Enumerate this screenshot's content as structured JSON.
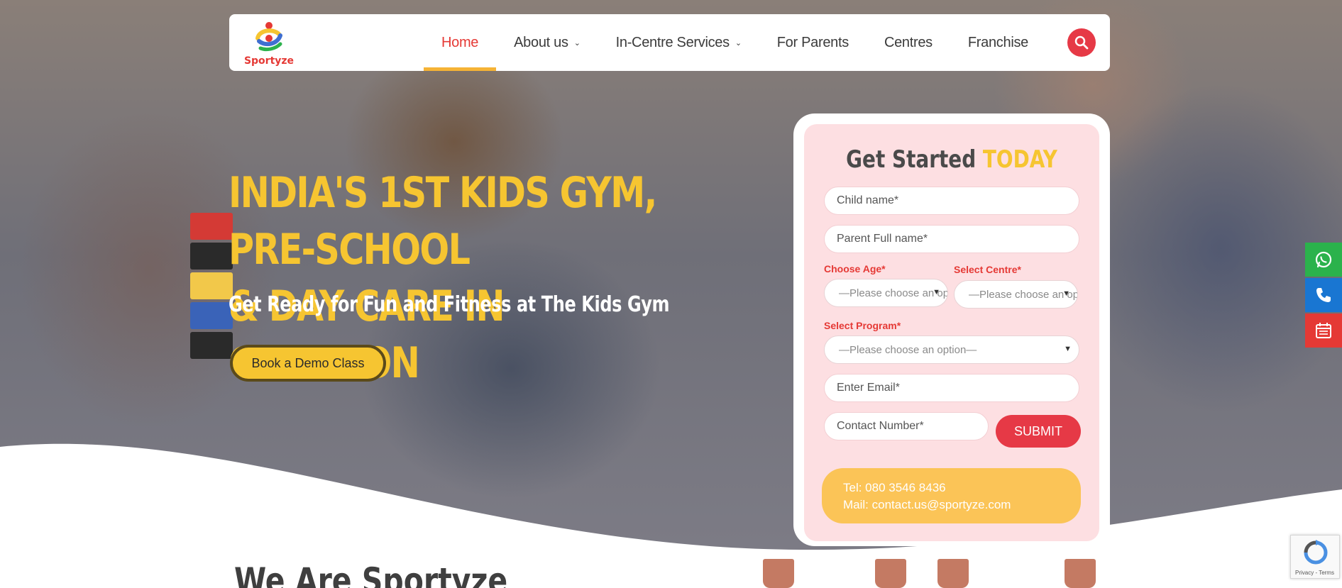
{
  "colors": {
    "brand_red": "#e63946",
    "brand_yellow": "#f6c531",
    "form_bg": "#fddfe2",
    "contact_bg": "#fbc457",
    "whatsapp": "#2bb24c",
    "phone": "#1976d2",
    "calendar": "#e53935"
  },
  "nav": {
    "logo_text": "Sportyze",
    "items": [
      {
        "label": "Home",
        "active": true,
        "dropdown": false
      },
      {
        "label": "About us",
        "active": false,
        "dropdown": true
      },
      {
        "label": "In-Centre Services",
        "active": false,
        "dropdown": true
      },
      {
        "label": "For Parents",
        "active": false,
        "dropdown": false
      },
      {
        "label": "Centres",
        "active": false,
        "dropdown": false
      },
      {
        "label": "Franchise",
        "active": false,
        "dropdown": false
      }
    ],
    "search_icon": "search-icon"
  },
  "hero": {
    "title_line1": "INDIA'S 1ST KIDS GYM, PRE-SCHOOL",
    "title_line2": "& DAY CARE IN GURGAON",
    "subtitle": "Get Ready for Fun and Fitness at The Kids Gym",
    "cta_label": "Book a Demo Class"
  },
  "form": {
    "title_prefix": "Get Started",
    "title_highlight": "TODAY",
    "child_name_placeholder": "Child name*",
    "parent_name_placeholder": "Parent Full name*",
    "age_label": "Choose Age*",
    "age_value": "—Please choose an option—",
    "centre_label": "Select Centre*",
    "centre_value": "—Please choose an option—",
    "program_label": "Select Program*",
    "program_value": "—Please choose an option—",
    "email_placeholder": "Enter Email*",
    "contact_placeholder": "Contact Number*",
    "submit_label": "SUBMIT",
    "tel": "Tel: 080 3546 8436",
    "mail": "Mail: contact.us@sportyze.com"
  },
  "side_buttons": [
    "whatsapp-icon",
    "phone-icon",
    "calendar-icon"
  ],
  "about": {
    "heading": "We Are Sportyze"
  },
  "recaptcha": {
    "label": "Privacy - Terms"
  }
}
